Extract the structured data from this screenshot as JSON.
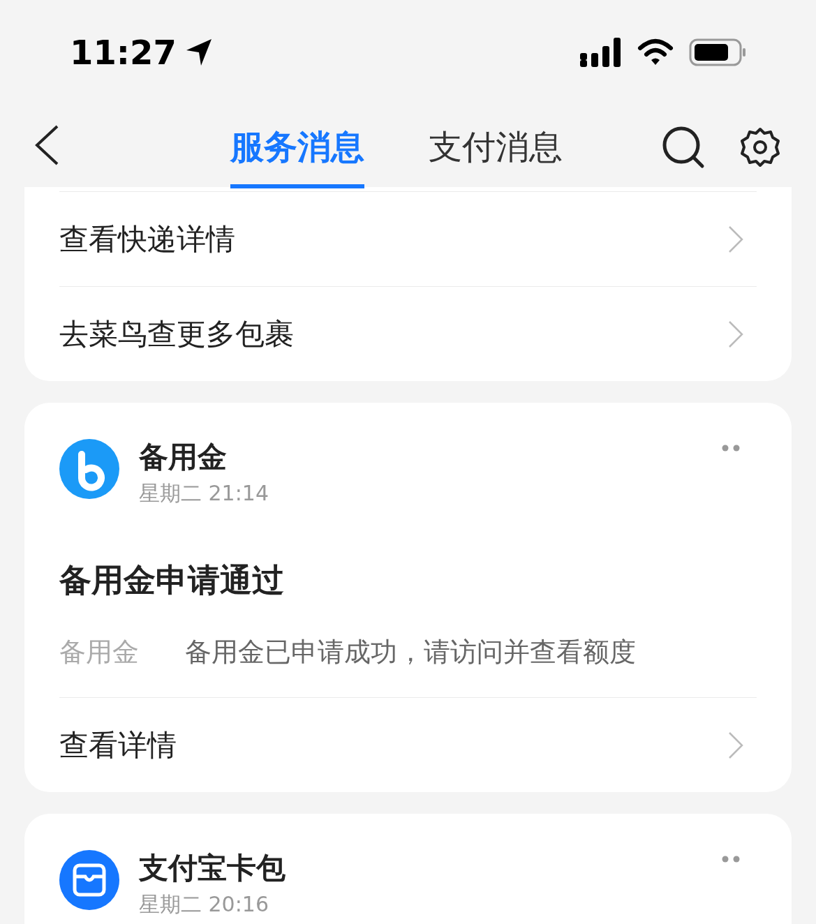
{
  "status_bar": {
    "time": "11:27"
  },
  "tabs": [
    {
      "label": "服务消息",
      "selected": true
    },
    {
      "label": "支付消息",
      "selected": false
    }
  ],
  "cards": [
    {
      "kind": "links",
      "links": [
        "查看快递详情",
        "去菜鸟查更多包裹"
      ]
    },
    {
      "kind": "message",
      "sender": "备用金",
      "time": "星期二 21:14",
      "title": "备用金申请通过",
      "field_label": "备用金",
      "field_value": "备用金已申请成功，请访问并查看额度",
      "links": [
        "查看详情"
      ]
    },
    {
      "kind": "message",
      "sender": "支付宝卡包",
      "time": "星期二 20:16"
    }
  ]
}
